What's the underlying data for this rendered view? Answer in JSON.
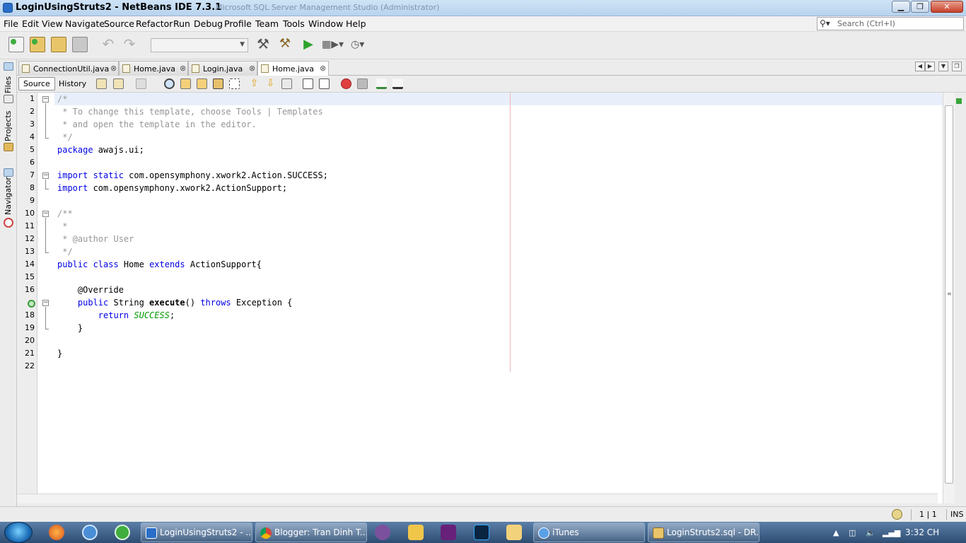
{
  "window": {
    "title": "LoginUsingStruts2 - NetBeans IDE 7.3.1",
    "background_title": "Microsoft SQL Server Management Studio (Administrator)",
    "minimize_label": "▁",
    "maximize_label": "❐",
    "close_label": "✕"
  },
  "menu": [
    "File",
    "Edit",
    "View",
    "Navigate",
    "Source",
    "Refactor",
    "Run",
    "Debug",
    "Profile",
    "Team",
    "Tools",
    "Window",
    "Help"
  ],
  "search": {
    "placeholder": "Search (Ctrl+I)",
    "icon": "magnifier-icon"
  },
  "toolbar": {
    "config_value": "",
    "icons": [
      "new-file-icon",
      "new-project-icon",
      "open-project-icon",
      "close-project-icon",
      "undo-icon",
      "redo-icon",
      "build-icon",
      "clean-build-icon",
      "run-icon",
      "debug-icon",
      "profile-icon"
    ]
  },
  "side_panel": {
    "tabs": [
      "Files",
      "Projects",
      "Navigator"
    ]
  },
  "editor_tabs": [
    {
      "label": "ConnectionUtil.java",
      "active": false
    },
    {
      "label": "Home.java",
      "active": false
    },
    {
      "label": "Login.java",
      "active": false
    },
    {
      "label": "Home.java",
      "active": true
    }
  ],
  "editor_toolbar": {
    "source_label": "Source",
    "history_label": "History"
  },
  "code_lines": [
    "1",
    "2",
    "3",
    "4",
    "5",
    "6",
    "7",
    "8",
    "9",
    "10",
    "11",
    "12",
    "13",
    "14",
    "15",
    "16",
    "17",
    "18",
    "19",
    "20",
    "21",
    "22"
  ],
  "code": {
    "l1": "/*",
    "l2": " * To change this template, choose Tools | Templates",
    "l3": " * and open the template in the editor.",
    "l4": " */",
    "l5_kw": "package",
    "l5_rest": " awajs.ui;",
    "l7_kw": "import static",
    "l7_rest": " com.opensymphony.xwork2.Action.SUCCESS;",
    "l8_kw": "import",
    "l8_rest": " com.opensymphony.xwork2.ActionSupport;",
    "l10": "/**",
    "l11": " *",
    "l12": " * @author User",
    "l13": " */",
    "l14_kw1": "public class",
    "l14_name": " Home ",
    "l14_kw2": "extends",
    "l14_rest": " ActionSupport{",
    "l16": "    @Override",
    "l17_kw": "    public",
    "l17_type": " String ",
    "l17_method": "execute",
    "l17_paren": "() ",
    "l17_throws": "throws",
    "l17_rest": " Exception {",
    "l18_kw": "        return",
    "l18_const": " SUCCESS",
    "l18_end": ";",
    "l19": "    }",
    "l21": "}"
  },
  "status": {
    "position": "1 | 1",
    "mode": "INS"
  },
  "taskbar": {
    "tasks": [
      {
        "label": "LoginUsingStruts2 - ...",
        "icon": "netbeans-icon"
      },
      {
        "label": "Blogger: Tran Dinh T...",
        "icon": "chrome-icon"
      },
      {
        "label": "iTunes",
        "icon": "itunes-icon"
      },
      {
        "label": "LoginStruts2.sql - DR...",
        "icon": "sql-server-icon"
      }
    ],
    "clock": "3:32 CH"
  }
}
